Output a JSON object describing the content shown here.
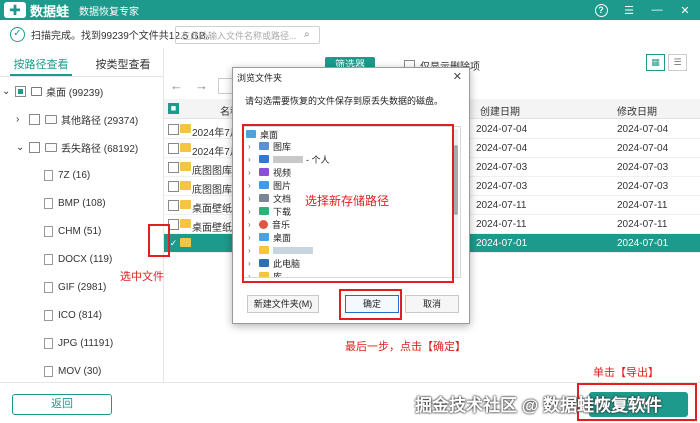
{
  "app": {
    "logo_text": "数据蛙",
    "subtitle": "数据恢复专家"
  },
  "status": {
    "text": "扫描完成。找到99239个文件共12.5 GB。"
  },
  "left_tabs": [
    "按路径查看",
    "按类型查看"
  ],
  "tree": {
    "root": "桌面 (99239)",
    "others": "其他路径 (29374)",
    "lost": "丢失路径 (68192)",
    "types": [
      "7Z (16)",
      "BMP (108)",
      "CHM (51)",
      "DOCX (119)",
      "GIF (2981)",
      "ICO (814)",
      "JPG (11191)",
      "MOV (30)"
    ]
  },
  "toolbar": {
    "search_placeholder": "在此处输入文件名称或路径...",
    "filter_label": "筛选器",
    "only_deleted_label": "仅显示删除项"
  },
  "table": {
    "headers": {
      "name": "名称",
      "created": "创建日期",
      "modified": "修改日期"
    },
    "rows": [
      {
        "name": "2024年7月",
        "created": "2024-07-04",
        "modified": "2024-07-04"
      },
      {
        "name": "2024年7月",
        "created": "2024-07-04",
        "modified": "2024-07-04"
      },
      {
        "name": "底图图库",
        "created": "2024-07-03",
        "modified": "2024-07-03"
      },
      {
        "name": "底图图库",
        "created": "2024-07-03",
        "modified": "2024-07-03"
      },
      {
        "name": "桌面壁纸",
        "created": "2024-07-11",
        "modified": "2024-07-11"
      },
      {
        "name": "桌面壁纸",
        "created": "2024-07-11",
        "modified": "2024-07-11"
      },
      {
        "name": "",
        "created": "2024-07-01",
        "modified": "2024-07-01"
      }
    ]
  },
  "dialog": {
    "title": "浏览文件夹",
    "prompt": "请勾选需要恢复的文件保存到原丢失数据的磁盘。",
    "tree": [
      {
        "label": "桌面",
        "indent": 0
      },
      {
        "label": "图库",
        "indent": 1
      },
      {
        "label": "- 个人",
        "indent": 1
      },
      {
        "label": "视频",
        "indent": 1
      },
      {
        "label": "图片",
        "indent": 1
      },
      {
        "label": "文档",
        "indent": 1
      },
      {
        "label": "下载",
        "indent": 1
      },
      {
        "label": "音乐",
        "indent": 1
      },
      {
        "label": "桌面",
        "indent": 1
      },
      {
        "label": "",
        "indent": 1
      },
      {
        "label": "此电脑",
        "indent": 1
      },
      {
        "label": "库",
        "indent": 1
      }
    ],
    "new_folder_label": "新建文件夹(M)",
    "ok_label": "确定",
    "cancel_label": "取消"
  },
  "annotations": {
    "select_file": "选中文件",
    "select_path": "选择新存储路径",
    "final_step": "最后一步，点击【确定】",
    "click_export": "单击【导出】"
  },
  "bottom": {
    "back_label": "返回",
    "export_label": "导出",
    "watermark": "掘金技术社区 @ 数据蛙恢复软件"
  },
  "colors": {
    "brand": "#1e9a8c",
    "annotation": "#e02020",
    "folder": "#f5c542"
  }
}
